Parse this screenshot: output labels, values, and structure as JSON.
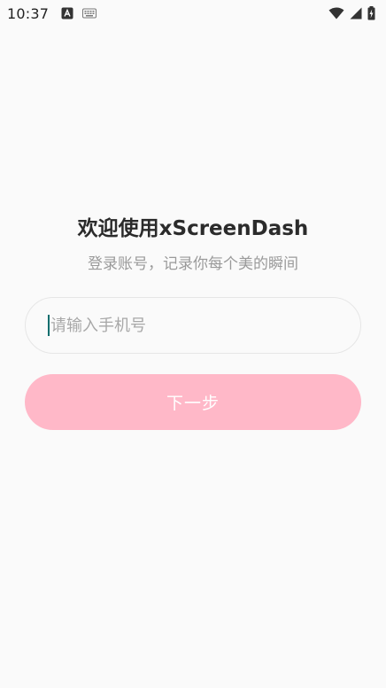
{
  "status_bar": {
    "time": "10:37",
    "icons": [
      "text-recognition-icon",
      "keyboard-icon",
      "wifi-icon",
      "cellular-signal-icon",
      "battery-charging-icon"
    ]
  },
  "welcome": {
    "title": "欢迎使用xScreenDash",
    "subtitle": "登录账号，记录你每个美的瞬间"
  },
  "login_form": {
    "phone_value": "",
    "phone_placeholder": "请输入手机号",
    "next_label": "下一步"
  },
  "colors": {
    "background": "#fafafa",
    "button_bg": "#ffb8c8",
    "button_text": "#ffffff",
    "cursor": "#0b6e6e"
  }
}
